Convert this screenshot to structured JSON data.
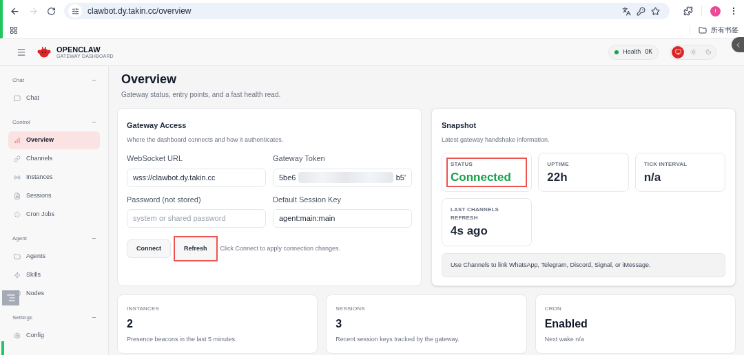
{
  "browser": {
    "url": "clawbot.dy.takin.cc/overview",
    "profile_initial": "I",
    "bookmarks_label": "所有书签"
  },
  "app": {
    "brand": "OPENCLAW",
    "subtitle": "GATEWAY DASHBOARD",
    "health_label": "Health",
    "health_value": "OK",
    "themes": [
      {
        "selected": true
      },
      {
        "selected": false
      },
      {
        "selected": false
      }
    ]
  },
  "sidebar": {
    "sections": [
      {
        "title": "Chat",
        "toggle": "–",
        "items": [
          {
            "label": "Chat",
            "selected": false
          }
        ]
      },
      {
        "title": "Control",
        "toggle": "–",
        "items": [
          {
            "label": "Overview",
            "selected": true
          },
          {
            "label": "Channels",
            "selected": false
          },
          {
            "label": "Instances",
            "selected": false
          },
          {
            "label": "Sessions",
            "selected": false
          },
          {
            "label": "Cron Jobs",
            "selected": false
          }
        ]
      },
      {
        "title": "Agent",
        "toggle": "–",
        "items": [
          {
            "label": "Agents",
            "selected": false
          },
          {
            "label": "Skills",
            "selected": false
          },
          {
            "label": "Nodes",
            "selected": false
          }
        ]
      },
      {
        "title": "Settings",
        "toggle": "–",
        "items": [
          {
            "label": "Config",
            "selected": false
          }
        ]
      }
    ]
  },
  "page": {
    "title": "Overview",
    "subtitle": "Gateway status, entry points, and a fast health read."
  },
  "gateway_access": {
    "title": "Gateway Access",
    "subtitle": "Where the dashboard connects and how it authenticates.",
    "fields": [
      {
        "label": "WebSocket URL",
        "value": "wss://clawbot.dy.takin.cc"
      },
      {
        "label": "Gateway Token",
        "value": "5be6",
        "value_end": "b5'",
        "redacted": true
      },
      {
        "label": "Password (not stored)",
        "placeholder": "system or shared password"
      },
      {
        "label": "Default Session Key",
        "value": "agent:main:main"
      }
    ],
    "buttons": [
      {
        "label": "Connect",
        "highlighted": false
      },
      {
        "label": "Refresh",
        "highlighted": true
      }
    ],
    "hint": "Click Connect to apply connection changes."
  },
  "snapshot": {
    "title": "Snapshot",
    "subtitle": "Latest gateway handshake information.",
    "stats": [
      {
        "label": "STATUS",
        "value": "Connected",
        "color": "#16a34a",
        "highlighted": true
      },
      {
        "label": "UPTIME",
        "value": "22h",
        "color": "#1f2937",
        "highlighted": false
      },
      {
        "label": "TICK INTERVAL",
        "value": "n/a",
        "color": "#1f2937",
        "highlighted": false
      },
      {
        "label": "LAST CHANNELS REFRESH",
        "value": "4s ago",
        "color": "#1f2937",
        "highlighted": false
      }
    ],
    "note": "Use Channels to link WhatsApp, Telegram, Discord, Signal, or iMessage."
  },
  "summary_cards": [
    {
      "label": "INSTANCES",
      "value": "2",
      "detail": "Presence beacons in the last 5 minutes."
    },
    {
      "label": "SESSIONS",
      "value": "3",
      "detail": "Recent session keys tracked by the gateway."
    },
    {
      "label": "CRON",
      "value": "Enabled",
      "detail": "Next wake n/a"
    }
  ]
}
